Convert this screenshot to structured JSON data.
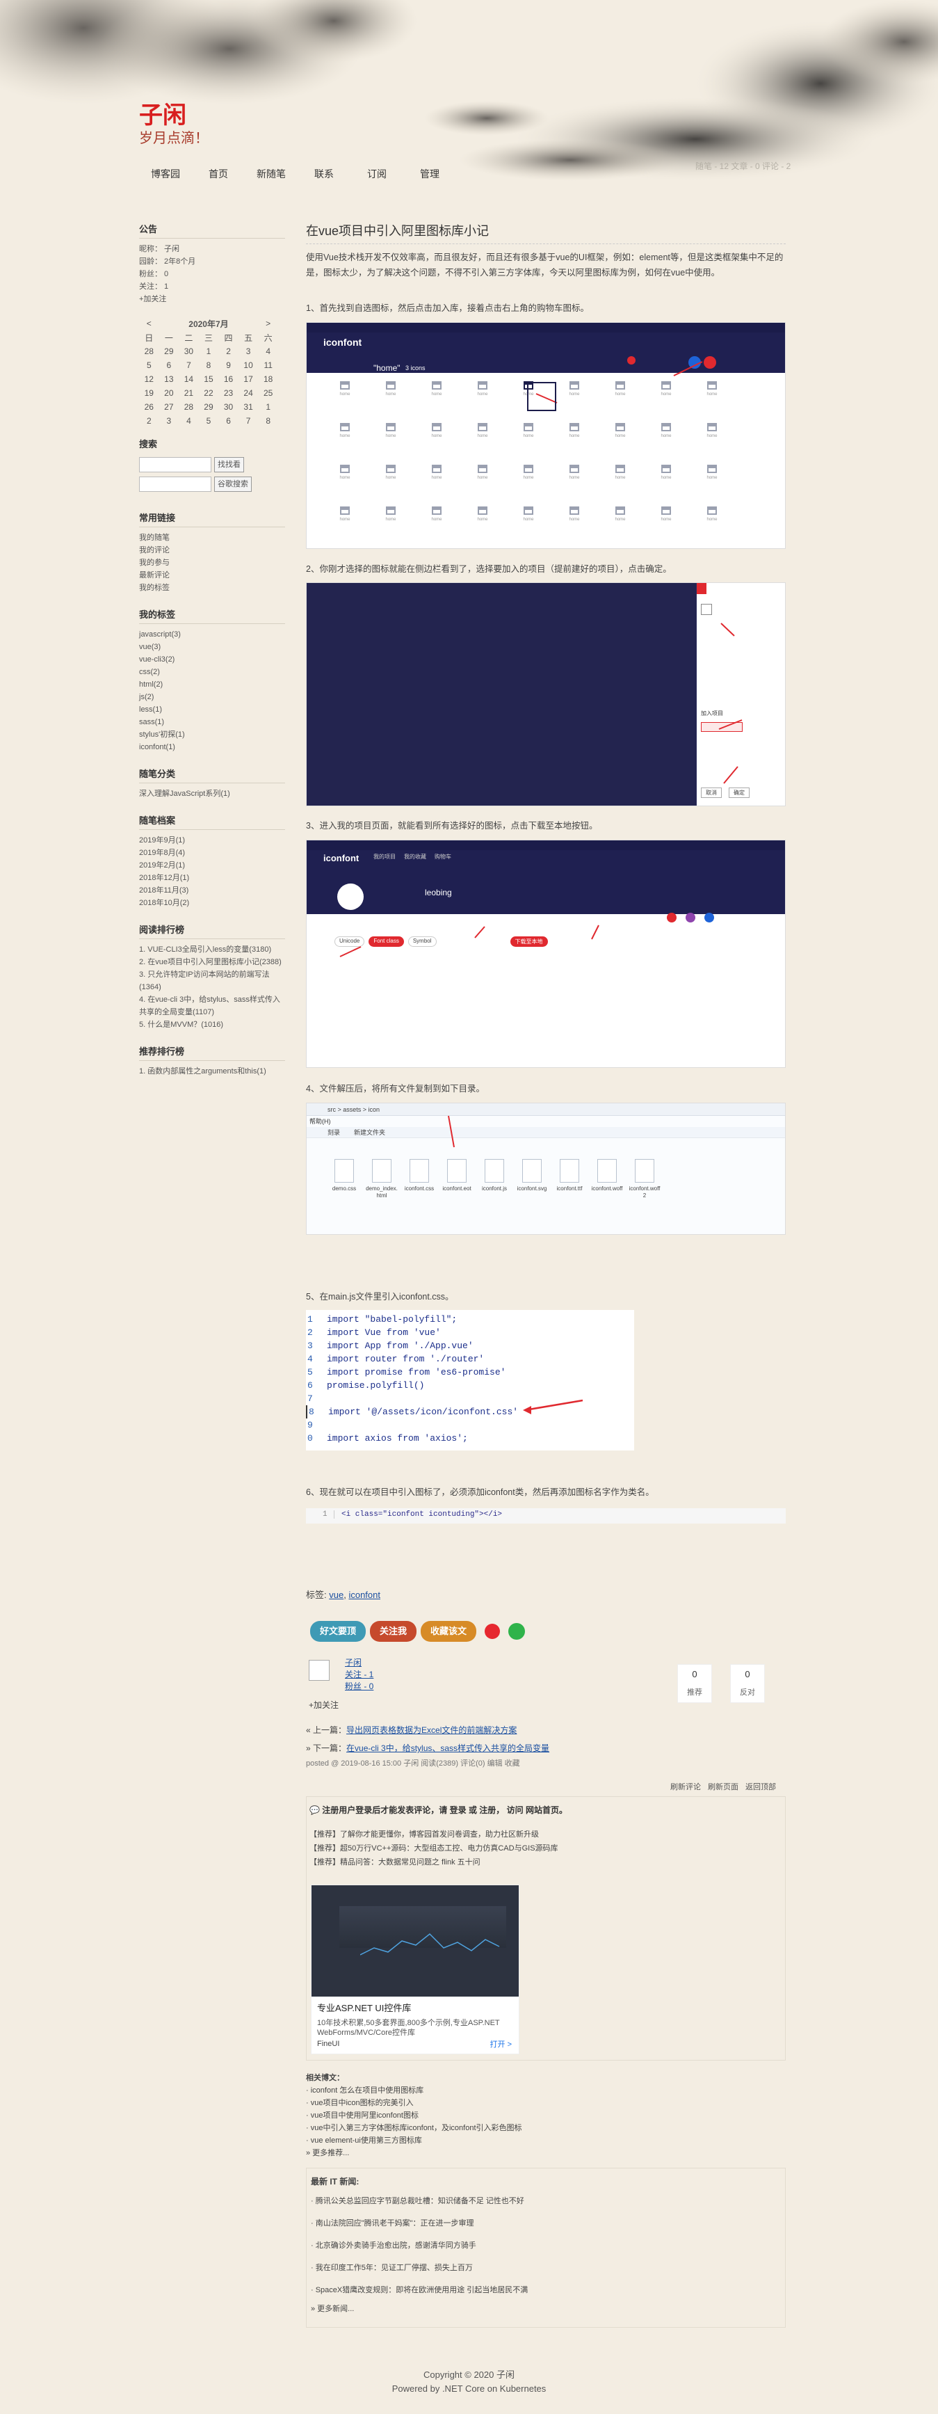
{
  "header": {
    "title": "子闲",
    "subtitle": "岁月点滴！",
    "stats": "随笔 - 12  文章 - 0  评论 - 2"
  },
  "nav": [
    "博客园",
    "首页",
    "新随笔",
    "联系",
    "订阅",
    "管理"
  ],
  "sidebar": {
    "notice_title": "公告",
    "profile": [
      "昵称： 子闲",
      "园龄： 2年8个月",
      "粉丝： 0",
      "关注： 1"
    ],
    "follow": "+加关注",
    "calendar": {
      "month": "2020年7月",
      "prev": "<",
      "next": ">",
      "weekdays": [
        "日",
        "一",
        "二",
        "三",
        "四",
        "五",
        "六"
      ],
      "rows": [
        [
          "28",
          "29",
          "30",
          "1",
          "2",
          "3",
          "4"
        ],
        [
          "5",
          "6",
          "7",
          "8",
          "9",
          "10",
          "11"
        ],
        [
          "12",
          "13",
          "14",
          "15",
          "16",
          "17",
          "18"
        ],
        [
          "19",
          "20",
          "21",
          "22",
          "23",
          "24",
          "25"
        ],
        [
          "26",
          "27",
          "28",
          "29",
          "30",
          "31",
          "1"
        ],
        [
          "2",
          "3",
          "4",
          "5",
          "6",
          "7",
          "8"
        ]
      ]
    },
    "search_title": "搜索",
    "search_btn": "找找看",
    "google_btn": "谷歌搜索",
    "links_title": "常用链接",
    "links": [
      "我的随笔",
      "我的评论",
      "我的参与",
      "最新评论",
      "我的标签"
    ],
    "tags_title": "我的标签",
    "tags": [
      "javascript(3)",
      "vue(3)",
      "vue-cli3(2)",
      "css(2)",
      "html(2)",
      "js(2)",
      "less(1)",
      "sass(1)",
      "stylus'初探(1)",
      "iconfont(1)"
    ],
    "cat_title": "随笔分类",
    "cats": [
      "深入理解JavaScript系列(1)"
    ],
    "archive_title": "随笔档案",
    "archives": [
      "2019年9月(1)",
      "2019年8月(4)",
      "2019年2月(1)",
      "2018年12月(1)",
      "2018年11月(3)",
      "2018年10月(2)"
    ],
    "rank_title": "阅读排行榜",
    "ranks": [
      "1. VUE-CLI3全局引入less的变量(3180)",
      "2. 在vue项目中引入阿里图标库小记(2388)",
      "3. 只允许特定IP访问本网站的前端写法(1364)",
      "4. 在vue-cli 3中，给stylus、sass样式传入共享的全局变量(1107)",
      "5. 什么是MVVM？(1016)"
    ],
    "rec_title": "推荐排行榜",
    "recs": [
      "1. 函数内部属性之arguments和this(1)"
    ]
  },
  "post": {
    "title": "在vue项目中引入阿里图标库小记",
    "intro": "使用Vue技术栈开发不仅效率高，而且很友好，而且还有很多基于vue的UI框架，例如：element等，但是这类框架集中不足的是，图标太少，为了解决这个问题，不得不引入第三方字体库，今天以阿里图标库为例，如何在vue中使用。",
    "step1": "1、首先找到自选图标，然后点击加入库，接着点击右上角的购物车图标。",
    "step2": "2、你刚才选择的图标就能在侧边栏看到了，选择要加入的项目（提前建好的项目），点击确定。",
    "step3": "3、进入我的项目页面，就能看到所有选择好的图标，点击下载至本地按钮。",
    "step4": "4、文件解压后，将所有文件复制到如下目录。",
    "step5": "5、在main.js文件里引入iconfont.css。",
    "step6": "6、现在就可以在项目中引入图标了，必须添加iconfont类，然后再添加图标名字作为类名。",
    "shot1": {
      "brand": "iconfont",
      "home": "\"home\"",
      "count": "3 icons",
      "labels": [
        "home",
        "home",
        "home",
        "home",
        "home",
        "home",
        "home",
        "home",
        "home",
        "home",
        "home",
        "home",
        "home",
        "home",
        "home",
        "home",
        "home",
        "home",
        "home",
        "home",
        "home",
        "home",
        "home",
        "home",
        "home",
        "home",
        "home",
        "home",
        "home",
        "home",
        "home",
        "home",
        "home",
        "home",
        "home",
        "home"
      ]
    },
    "shot2": {
      "label_title": "加入项目",
      "cancel": "取消",
      "confirm": "确定"
    },
    "shot3": {
      "brand": "iconfont",
      "user": "leobing",
      "tabs": [
        "Unicode",
        "Font class",
        "Symbol"
      ],
      "download": "下载至本地",
      "tab_labels": [
        "我的项目",
        "我的收藏",
        "购物车"
      ]
    },
    "shot4": {
      "path": "src > assets > icon",
      "menu": "帮助(H)",
      "toolbar": [
        "刻录",
        "新建文件夹"
      ],
      "files": [
        "demo.css",
        "demo_index.html",
        "iconfont.css",
        "iconfont.eot",
        "iconfont.js",
        "iconfont.svg",
        "iconfont.ttf",
        "iconfont.woff",
        "iconfont.woff2"
      ]
    },
    "code": [
      {
        "n": "1",
        "t": "import \"babel-polyfill\";"
      },
      {
        "n": "2",
        "t": "import Vue from 'vue'"
      },
      {
        "n": "3",
        "t": "import App from './App.vue'"
      },
      {
        "n": "4",
        "t": "import router from './router'"
      },
      {
        "n": "5",
        "t": "import promise from 'es6-promise'"
      },
      {
        "n": "6",
        "t": "promise.polyfill()"
      },
      {
        "n": "7",
        "t": ""
      },
      {
        "n": "8",
        "t": "import '@/assets/icon/iconfont.css'"
      },
      {
        "n": "9",
        "t": ""
      },
      {
        "n": "0",
        "t": "import axios from 'axios';"
      }
    ],
    "code2": {
      "n": "1",
      "t": "<i class=\"iconfont icontuding\"></i>"
    },
    "tags_label": "标签:",
    "tags": [
      "vue",
      "iconfont"
    ],
    "share_btns": [
      "好文要顶",
      "关注我",
      "收藏该文"
    ],
    "author": {
      "name": "子闲",
      "following": "关注 - 1",
      "fans": "粉丝 - 0",
      "follow": "+加关注"
    },
    "digg": {
      "count": "0",
      "label": "推荐"
    },
    "bury": {
      "count": "0",
      "label": "反对"
    },
    "prev_label": "« 上一篇：",
    "prev": "导出网页表格数据为Excel文件的前端解决方案",
    "next_label": "» 下一篇：",
    "next": "在vue-cli 3中，给stylus、sass样式传入共享的全局变量",
    "posted": "posted @ 2019-08-16 15:00  子闲  阅读(2389)  评论(0)  编辑  收藏",
    "comment_links": [
      "刷新评论",
      "刷新页面",
      "返回顶部"
    ],
    "login_note": "注册用户登录后才能发表评论，请 登录 或 注册， 访问 网站首页。",
    "ads": [
      "【推荐】了解你才能更懂你，博客园首发问卷调查，助力社区新升级",
      "【推荐】超50万行VC++源码：大型组态工控、电力仿真CAD与GIS源码库",
      "【推荐】精品问答：大数据常见问题之 flink 五十问"
    ],
    "ad": {
      "title": "专业ASP.NET UI控件库",
      "desc": "10年技术积累,50多套界面,800多个示例,专业ASP.NET WebForms/MVC/Core控件库",
      "brand": "FineUI",
      "open": "打开 >"
    },
    "related_title": "相关博文：",
    "related": [
      "· iconfont 怎么在项目中使用图标库",
      "· vue项目中icon图标的完美引入",
      "· vue项目中使用阿里iconfont图标",
      "· vue中引入第三方字体图标库iconfont，及iconfont引入彩色图标",
      "· vue element-ui使用第三方图标库"
    ],
    "more": "» 更多推荐...",
    "news_title": "最新 IT 新闻:",
    "news": [
      "· 腾讯公关总监回应字节副总裁吐槽：知识储备不足 记性也不好",
      "· 南山法院回应\"腾讯老干妈案\"：正在进一步审理",
      "· 北京确诊外卖骑手治愈出院，感谢清华同方骑手",
      "· 我在印度工作5年：见证工厂停摆、损失上百万",
      "· SpaceX猎鹰改变规则：即将在欧洲使用用途 引起当地居民不满"
    ],
    "more_news": "» 更多新闻..."
  },
  "footer": {
    "copyright": "Copyright © 2020 子闲",
    "powered": "Powered by .NET Core on Kubernetes"
  },
  "colors": {
    "title_red": "#d81f1f",
    "bg": "#f3ede2",
    "iconfont_dark": "#1b1c4a",
    "red_btn": "#e0292f"
  }
}
